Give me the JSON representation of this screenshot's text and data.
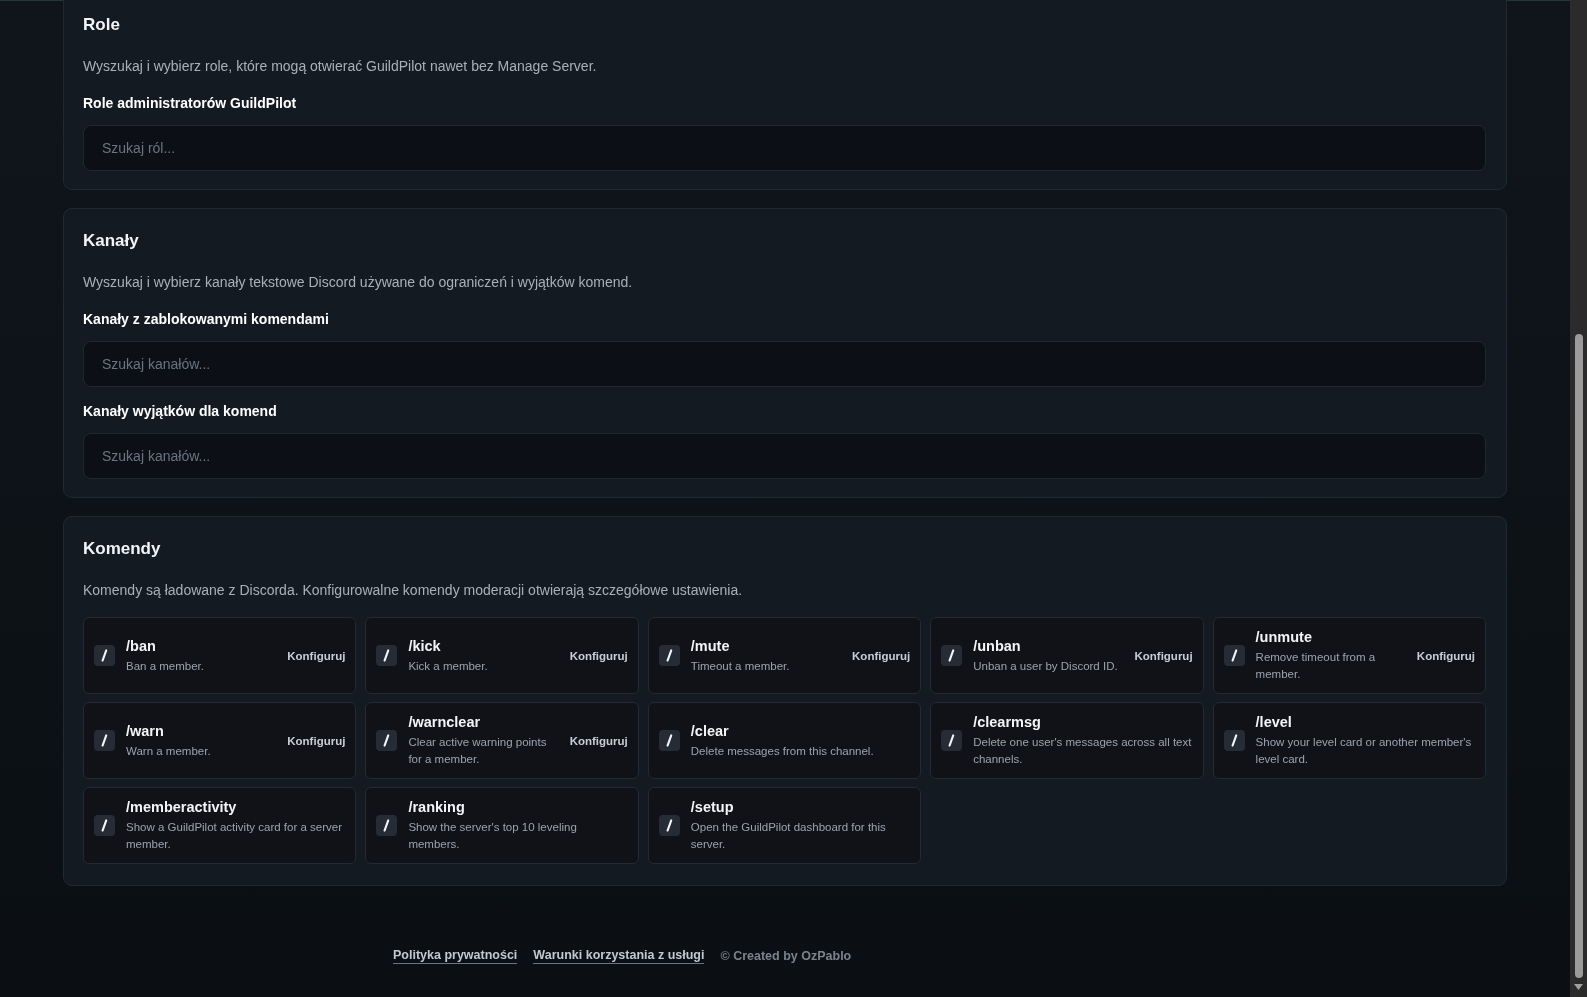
{
  "sections": [
    {
      "kind": "search_fields",
      "title": "Role",
      "description": "Wyszukaj i wybierz role, które mogą otwierać GuildPilot nawet bez Manage Server.",
      "fields": [
        {
          "label": "Role administratorów GuildPilot",
          "placeholder": "Szukaj ról..."
        }
      ]
    },
    {
      "kind": "search_fields",
      "title": "Kanały",
      "description": "Wyszukaj i wybierz kanały tekstowe Discord używane do ograniczeń i wyjątków komend.",
      "fields": [
        {
          "label": "Kanały z zablokowanymi komendami",
          "placeholder": "Szukaj kanałów..."
        },
        {
          "label": "Kanały wyjątków dla komend",
          "placeholder": "Szukaj kanałów..."
        }
      ]
    },
    {
      "kind": "commands",
      "title": "Komendy",
      "description": "Komendy są ładowane z Discorda. Konfigurowalne komendy moderacji otwierają szczegółowe ustawienia.",
      "commands": [
        {
          "name": "/ban",
          "description": "Ban a member.",
          "action": "Konfiguruj"
        },
        {
          "name": "/kick",
          "description": "Kick a member.",
          "action": "Konfiguruj"
        },
        {
          "name": "/mute",
          "description": "Timeout a member.",
          "action": "Konfiguruj"
        },
        {
          "name": "/unban",
          "description": "Unban a user by Discord ID.",
          "action": "Konfiguruj"
        },
        {
          "name": "/unmute",
          "description": "Remove timeout from a member.",
          "action": "Konfiguruj"
        },
        {
          "name": "/warn",
          "description": "Warn a member.",
          "action": "Konfiguruj"
        },
        {
          "name": "/warnclear",
          "description": "Clear active warning points for a member.",
          "action": "Konfiguruj"
        },
        {
          "name": "/clear",
          "description": "Delete messages from this channel."
        },
        {
          "name": "/clearmsg",
          "description": "Delete one user's messages across all text channels."
        },
        {
          "name": "/level",
          "description": "Show your level card or another member's level card."
        },
        {
          "name": "/memberactivity",
          "description": "Show a GuildPilot activity card for a server member."
        },
        {
          "name": "/ranking",
          "description": "Show the server's top 10 leveling members."
        },
        {
          "name": "/setup",
          "description": "Open the GuildPilot dashboard for this server."
        }
      ]
    }
  ],
  "footer": {
    "links": [
      "Polityka prywatności",
      "Warunki korzystania z usługi"
    ],
    "credit": "© Created by OzPablo"
  }
}
